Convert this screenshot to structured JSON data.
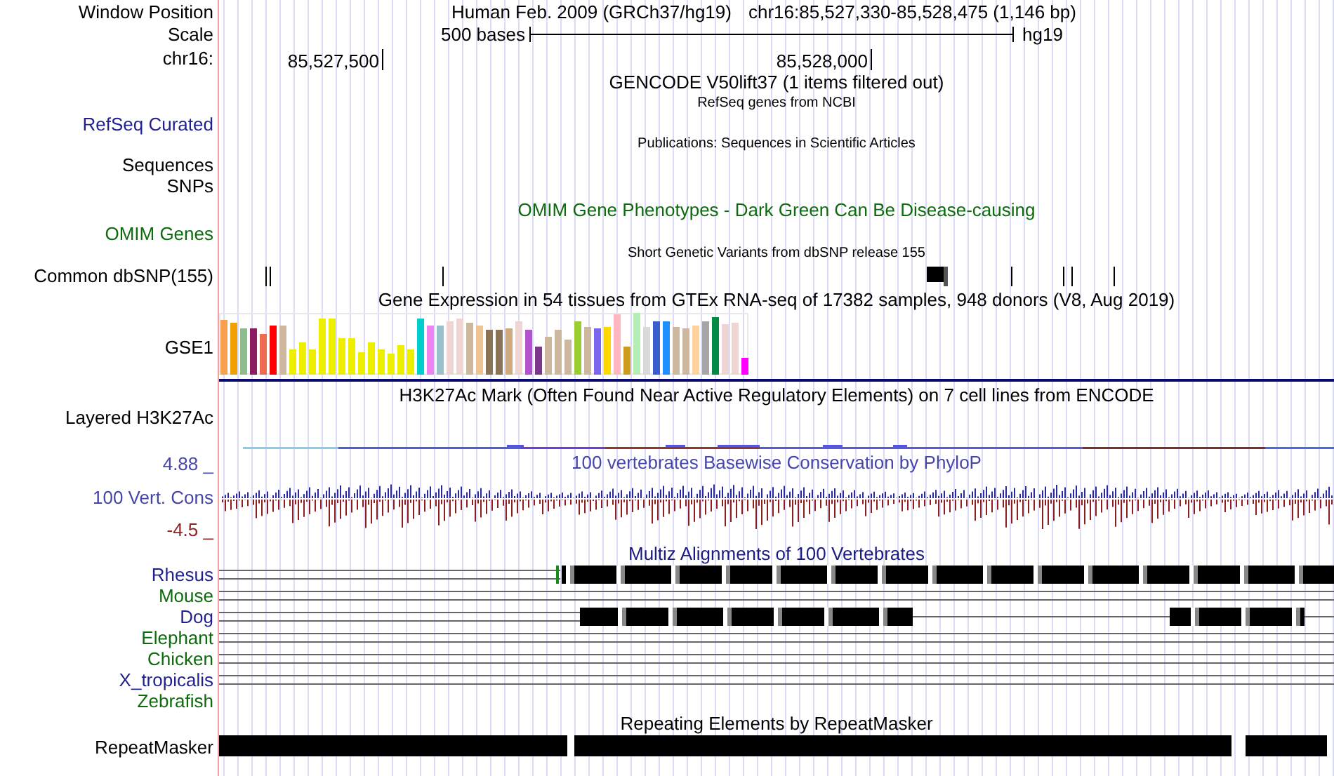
{
  "header": {
    "label": "Window Position",
    "assembly": "Human Feb. 2009 (GRCh37/hg19)",
    "position": "chr16:85,527,330-85,528,475 (1,146 bp)"
  },
  "scale": {
    "label": "Scale",
    "length": "500 bases",
    "assembly": "hg19"
  },
  "ruler": {
    "label": "chr16:",
    "ticks": [
      "85,527,500",
      "85,528,000"
    ]
  },
  "tracks": [
    {
      "kind": "title",
      "title": "GENCODE V50lift37 (1 items filtered out)",
      "color": "#000000"
    },
    {
      "kind": "note",
      "title": "RefSeq genes from NCBI"
    },
    {
      "kind": "label",
      "label": "RefSeq Curated",
      "color": "#1f1f8f"
    },
    {
      "kind": "note",
      "title": "Publications: Sequences in Scientific Articles"
    },
    {
      "kind": "label",
      "label": "Sequences",
      "color": "#000000"
    },
    {
      "kind": "label",
      "label": "SNPs",
      "color": "#000000"
    },
    {
      "kind": "title",
      "title": "OMIM Gene Phenotypes - Dark Green Can Be Disease-causing",
      "color": "#0d6b0d"
    },
    {
      "kind": "label",
      "label": "OMIM Genes",
      "color": "#0d6b0d"
    },
    {
      "kind": "note",
      "title": "Short Genetic Variants from dbSNP release 155"
    },
    {
      "kind": "snps",
      "label": "Common dbSNP(155)",
      "color": "#000000"
    },
    {
      "kind": "title",
      "title": "Gene Expression in 54 tissues from GTEx RNA-seq of 17382 samples, 948 donors (V8, Aug 2019)",
      "color": "#000000"
    },
    {
      "kind": "expression",
      "label": "GSE1",
      "color": "#000000",
      "bars": [
        {
          "color": "#f9a050"
        },
        {
          "color": "#f0a000"
        },
        {
          "color": "#8fbc8f"
        },
        {
          "color": "#8b1c62"
        },
        {
          "color": "#ee6a50"
        },
        {
          "color": "#ff0000"
        },
        {
          "color": "#cdb79e"
        },
        {
          "color": "#eeee00"
        },
        {
          "color": "#eeee00"
        },
        {
          "color": "#eeee00"
        },
        {
          "color": "#eeee00"
        },
        {
          "color": "#eeee00"
        },
        {
          "color": "#eeee00"
        },
        {
          "color": "#eeee00"
        },
        {
          "color": "#eeee00"
        },
        {
          "color": "#eeee00"
        },
        {
          "color": "#eeee00"
        },
        {
          "color": "#eeee00"
        },
        {
          "color": "#eeee00"
        },
        {
          "color": "#eeee00"
        },
        {
          "color": "#00cdcd"
        },
        {
          "color": "#ee82ee"
        },
        {
          "color": "#9ac0cd"
        },
        {
          "color": "#eed5d2"
        },
        {
          "color": "#eed5d2"
        },
        {
          "color": "#cdb79e"
        },
        {
          "color": "#eec591"
        },
        {
          "color": "#8b7355"
        },
        {
          "color": "#8b7355"
        },
        {
          "color": "#cdaa7d"
        },
        {
          "color": "#eed5d2"
        },
        {
          "color": "#b452cd"
        },
        {
          "color": "#7a378b"
        },
        {
          "color": "#cdb79e"
        },
        {
          "color": "#cdb79e"
        },
        {
          "color": "#cdb79e"
        },
        {
          "color": "#9acd32"
        },
        {
          "color": "#cdb79e"
        },
        {
          "color": "#7a67ee"
        },
        {
          "color": "#ffd700"
        },
        {
          "color": "#ffb6c1"
        },
        {
          "color": "#cd9b1d"
        },
        {
          "color": "#b4eeb4"
        },
        {
          "color": "#d9d9d9"
        },
        {
          "color": "#3a5fcd"
        },
        {
          "color": "#1e90ff"
        },
        {
          "color": "#cdb79e"
        },
        {
          "color": "#cdb79e"
        },
        {
          "color": "#ffd39b"
        },
        {
          "color": "#a6a6a6"
        },
        {
          "color": "#008b45"
        },
        {
          "color": "#eed5d2"
        },
        {
          "color": "#eed5d2"
        },
        {
          "color": "#ff00ff"
        }
      ]
    },
    {
      "kind": "title",
      "title": "H3K27Ac Mark (Often Found Near Active Regulatory Elements) on 7 cell lines from ENCODE",
      "color": "#000000"
    },
    {
      "kind": "layered",
      "label": "Layered H3K27Ac",
      "color": "#000000"
    },
    {
      "kind": "conservation",
      "title": "100 vertebrates Basewise Conservation by PhyloP",
      "label": "100 Vert. Cons",
      "color": "#4646aa",
      "axis_labels": [
        {
          "text": "4.88 _",
          "color": "#4646aa"
        },
        {
          "text": "-4.5 _",
          "color": "#8b2525"
        }
      ]
    },
    {
      "kind": "multiz",
      "title": "Multiz Alignments of 100 Vertebrates",
      "color": "#1a1a80",
      "species": [
        {
          "name": "Rhesus",
          "color": "#1f1f8f",
          "kind": "right_block"
        },
        {
          "name": "Mouse",
          "color": "#0d6b0d",
          "kind": "line"
        },
        {
          "name": "Dog",
          "color": "#1f1f8f",
          "kind": "patches"
        },
        {
          "name": "Elephant",
          "color": "#0d6b0d",
          "kind": "line"
        },
        {
          "name": "Chicken",
          "color": "#0d6b0d",
          "kind": "line"
        },
        {
          "name": "X_tropicalis",
          "color": "#1f1f8f",
          "kind": "line"
        },
        {
          "name": "Zebrafish",
          "color": "#0d6b0d",
          "kind": "none"
        }
      ]
    },
    {
      "kind": "title",
      "title": "Repeating Elements by RepeatMasker",
      "color": "#000000"
    },
    {
      "kind": "repeats",
      "label": "RepeatMasker",
      "color": "#000000"
    }
  ]
}
